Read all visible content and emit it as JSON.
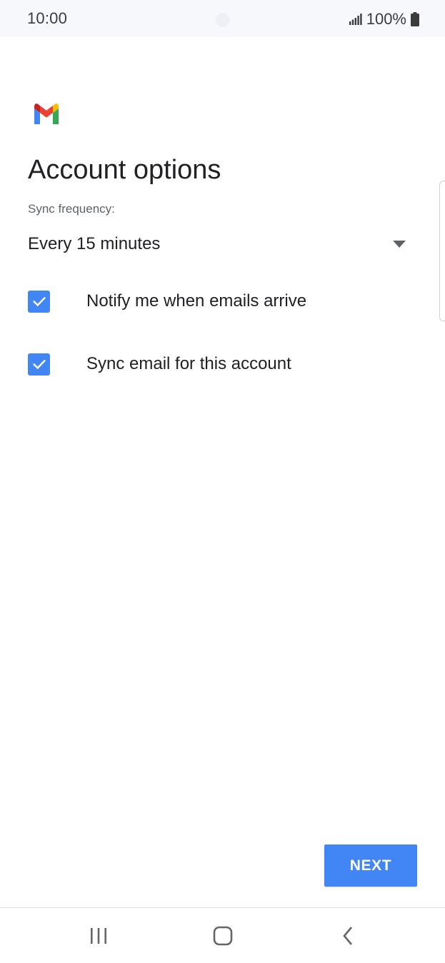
{
  "status_bar": {
    "time": "10:00",
    "battery_text": "100%",
    "icons": [
      "signal-icon",
      "battery-icon"
    ]
  },
  "app": {
    "logo": "gmail-logo",
    "colors": {
      "accent": "#4285f4",
      "gmail_red": "#ea4335",
      "gmail_yellow": "#fbbc04",
      "gmail_green": "#34a853",
      "gmail_blue": "#4285f4"
    }
  },
  "main": {
    "title": "Account options",
    "sync_frequency_label": "Sync frequency:",
    "sync_frequency_value": "Every 15 minutes",
    "options": [
      {
        "label": "Notify me when emails arrive",
        "checked": true
      },
      {
        "label": "Sync email for this account",
        "checked": true
      }
    ],
    "next_label": "NEXT"
  },
  "nav_bar": {
    "buttons": [
      "recents-icon",
      "home-icon",
      "back-icon"
    ]
  }
}
